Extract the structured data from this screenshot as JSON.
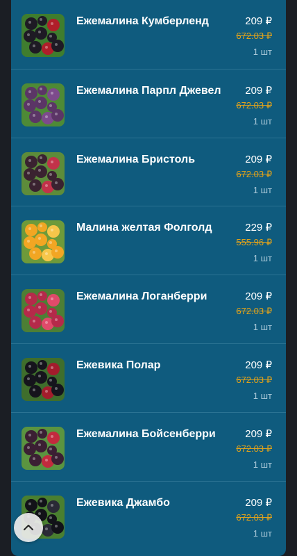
{
  "cart": {
    "items": [
      {
        "name": "Ежемалина Кумберленд",
        "price": "209 ₽",
        "old_price": "672.03 ₽",
        "qty": "1 шт",
        "image": "blackcap-raspberry-photo",
        "berry_color": "#1e1a24",
        "leaf_color": "#3f7d2e",
        "accent_color": "#b01e2a"
      },
      {
        "name": "Ежемалина Парпл Джевел",
        "price": "209 ₽",
        "old_price": "672.03 ₽",
        "qty": "1 шт",
        "image": "purple-raspberry-photo",
        "berry_color": "#5b3566",
        "leaf_color": "#4e8a36",
        "accent_color": "#7d4a8c"
      },
      {
        "name": "Ежемалина Бристоль",
        "price": "209 ₽",
        "old_price": "672.03 ₽",
        "qty": "1 шт",
        "image": "black-red-raspberry-photo",
        "berry_color": "#3a2230",
        "leaf_color": "#5d8c3a",
        "accent_color": "#c2324a"
      },
      {
        "name": "Малина желтая Фолголд",
        "price": "229 ₽",
        "old_price": "555.96 ₽",
        "qty": "1 шт",
        "image": "yellow-raspberry-photo",
        "berry_color": "#f2a623",
        "leaf_color": "#6e9a3a",
        "accent_color": "#f7c64a"
      },
      {
        "name": "Ежемалина Логанберри",
        "price": "209 ₽",
        "old_price": "672.03 ₽",
        "qty": "1 шт",
        "image": "loganberry-photo",
        "berry_color": "#b52a4a",
        "leaf_color": "#4d7f35",
        "accent_color": "#e04a6a"
      },
      {
        "name": "Ежевика Полар",
        "price": "209 ₽",
        "old_price": "672.03 ₽",
        "qty": "1 шт",
        "image": "blackberry-photo",
        "berry_color": "#15141c",
        "leaf_color": "#3f6e2c",
        "accent_color": "#a31c2c"
      },
      {
        "name": "Ежемалина Бойсенберри",
        "price": "209 ₽",
        "old_price": "672.03 ₽",
        "qty": "1 шт",
        "image": "boysenberry-photo",
        "berry_color": "#3b1f33",
        "leaf_color": "#5b9440",
        "accent_color": "#c22a3e"
      },
      {
        "name": "Ежевика Джамбо",
        "price": "209 ₽",
        "old_price": "672.03 ₽",
        "qty": "1 шт",
        "image": "jumbo-blackberry-photo",
        "berry_color": "#121218",
        "leaf_color": "#4a7f30",
        "accent_color": "#2a2a36"
      }
    ]
  },
  "scroll_top_button": {
    "icon": "chevron-up-icon"
  }
}
